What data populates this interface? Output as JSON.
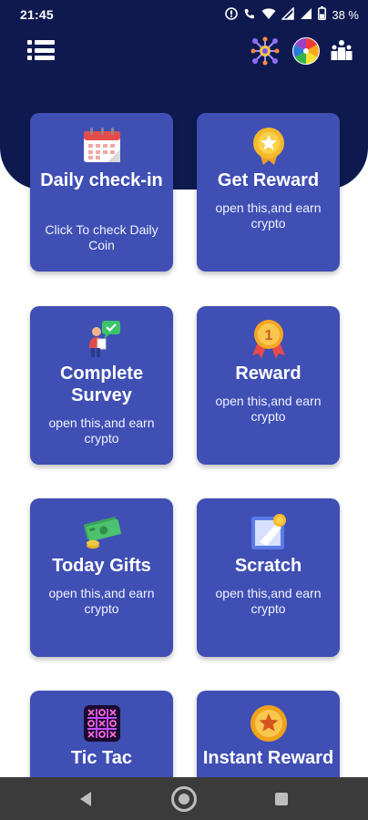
{
  "status_bar": {
    "time": "21:45",
    "battery": "38 %"
  },
  "header": {
    "menu_icon": "hamburger-list-icon",
    "icons": [
      "network-nodes-icon",
      "color-wheel-icon",
      "leaderboard-icon"
    ]
  },
  "cards": [
    {
      "title": "Daily check-in",
      "desc": "Click To check Daily Coin",
      "icon": "calendar-icon"
    },
    {
      "title": "Get Reward",
      "desc": "open this,and earn crypto",
      "icon": "gold-star-medal-icon"
    },
    {
      "title": "Complete Survey",
      "desc": "open this,and earn crypto",
      "icon": "survey-person-icon"
    },
    {
      "title": "Reward",
      "desc": "open this,and earn crypto",
      "icon": "ribbon-medal-icon"
    },
    {
      "title": "Today Gifts",
      "desc": "open this,and earn crypto",
      "icon": "cash-stack-icon"
    },
    {
      "title": "Scratch",
      "desc": "open this,and earn crypto",
      "icon": "scratch-card-icon"
    },
    {
      "title": "Tic Tac",
      "desc": "",
      "icon": "tic-tac-toe-icon"
    },
    {
      "title": "Instant Reward",
      "desc": "",
      "icon": "coin-star-icon"
    }
  ],
  "colors": {
    "header_bg": "#0e1a4f",
    "card_bg": "#3f4fb4",
    "nav_bg": "#3b3b3b"
  }
}
